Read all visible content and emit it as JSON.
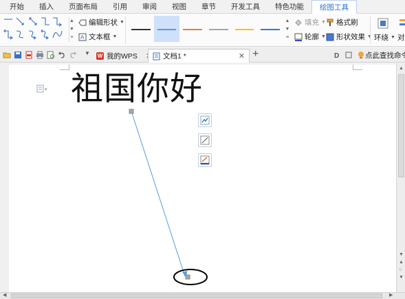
{
  "ribbon_tabs": [
    {
      "label": "开始"
    },
    {
      "label": "插入"
    },
    {
      "label": "页面布局"
    },
    {
      "label": "引用"
    },
    {
      "label": "审阅"
    },
    {
      "label": "视图"
    },
    {
      "label": "章节"
    },
    {
      "label": "开发工具"
    },
    {
      "label": "特色功能"
    },
    {
      "label": "绘图工具"
    }
  ],
  "ribbon": {
    "edit_shape": "编辑形状",
    "text_box": "文本框",
    "fill": "填充",
    "format_painter": "格式刷",
    "outline": "轮廓",
    "shape_effect": "形状效果",
    "wrap": "环绕",
    "align": "对齐",
    "line_style_colors": [
      "#333333",
      "#5b9bd5",
      "#ed7d31",
      "#a5a5a5",
      "#ffc000",
      "#4472c4"
    ]
  },
  "quickbar": {
    "my_wps": "我的WPS",
    "doc_tab": "文档1 *",
    "add_tab": "+",
    "search_cmd": "点此查找命令"
  },
  "document": {
    "text": "祖国你好"
  },
  "icons": {
    "accent": "#2b6fd6",
    "connector_color": "#5b9bd5"
  }
}
